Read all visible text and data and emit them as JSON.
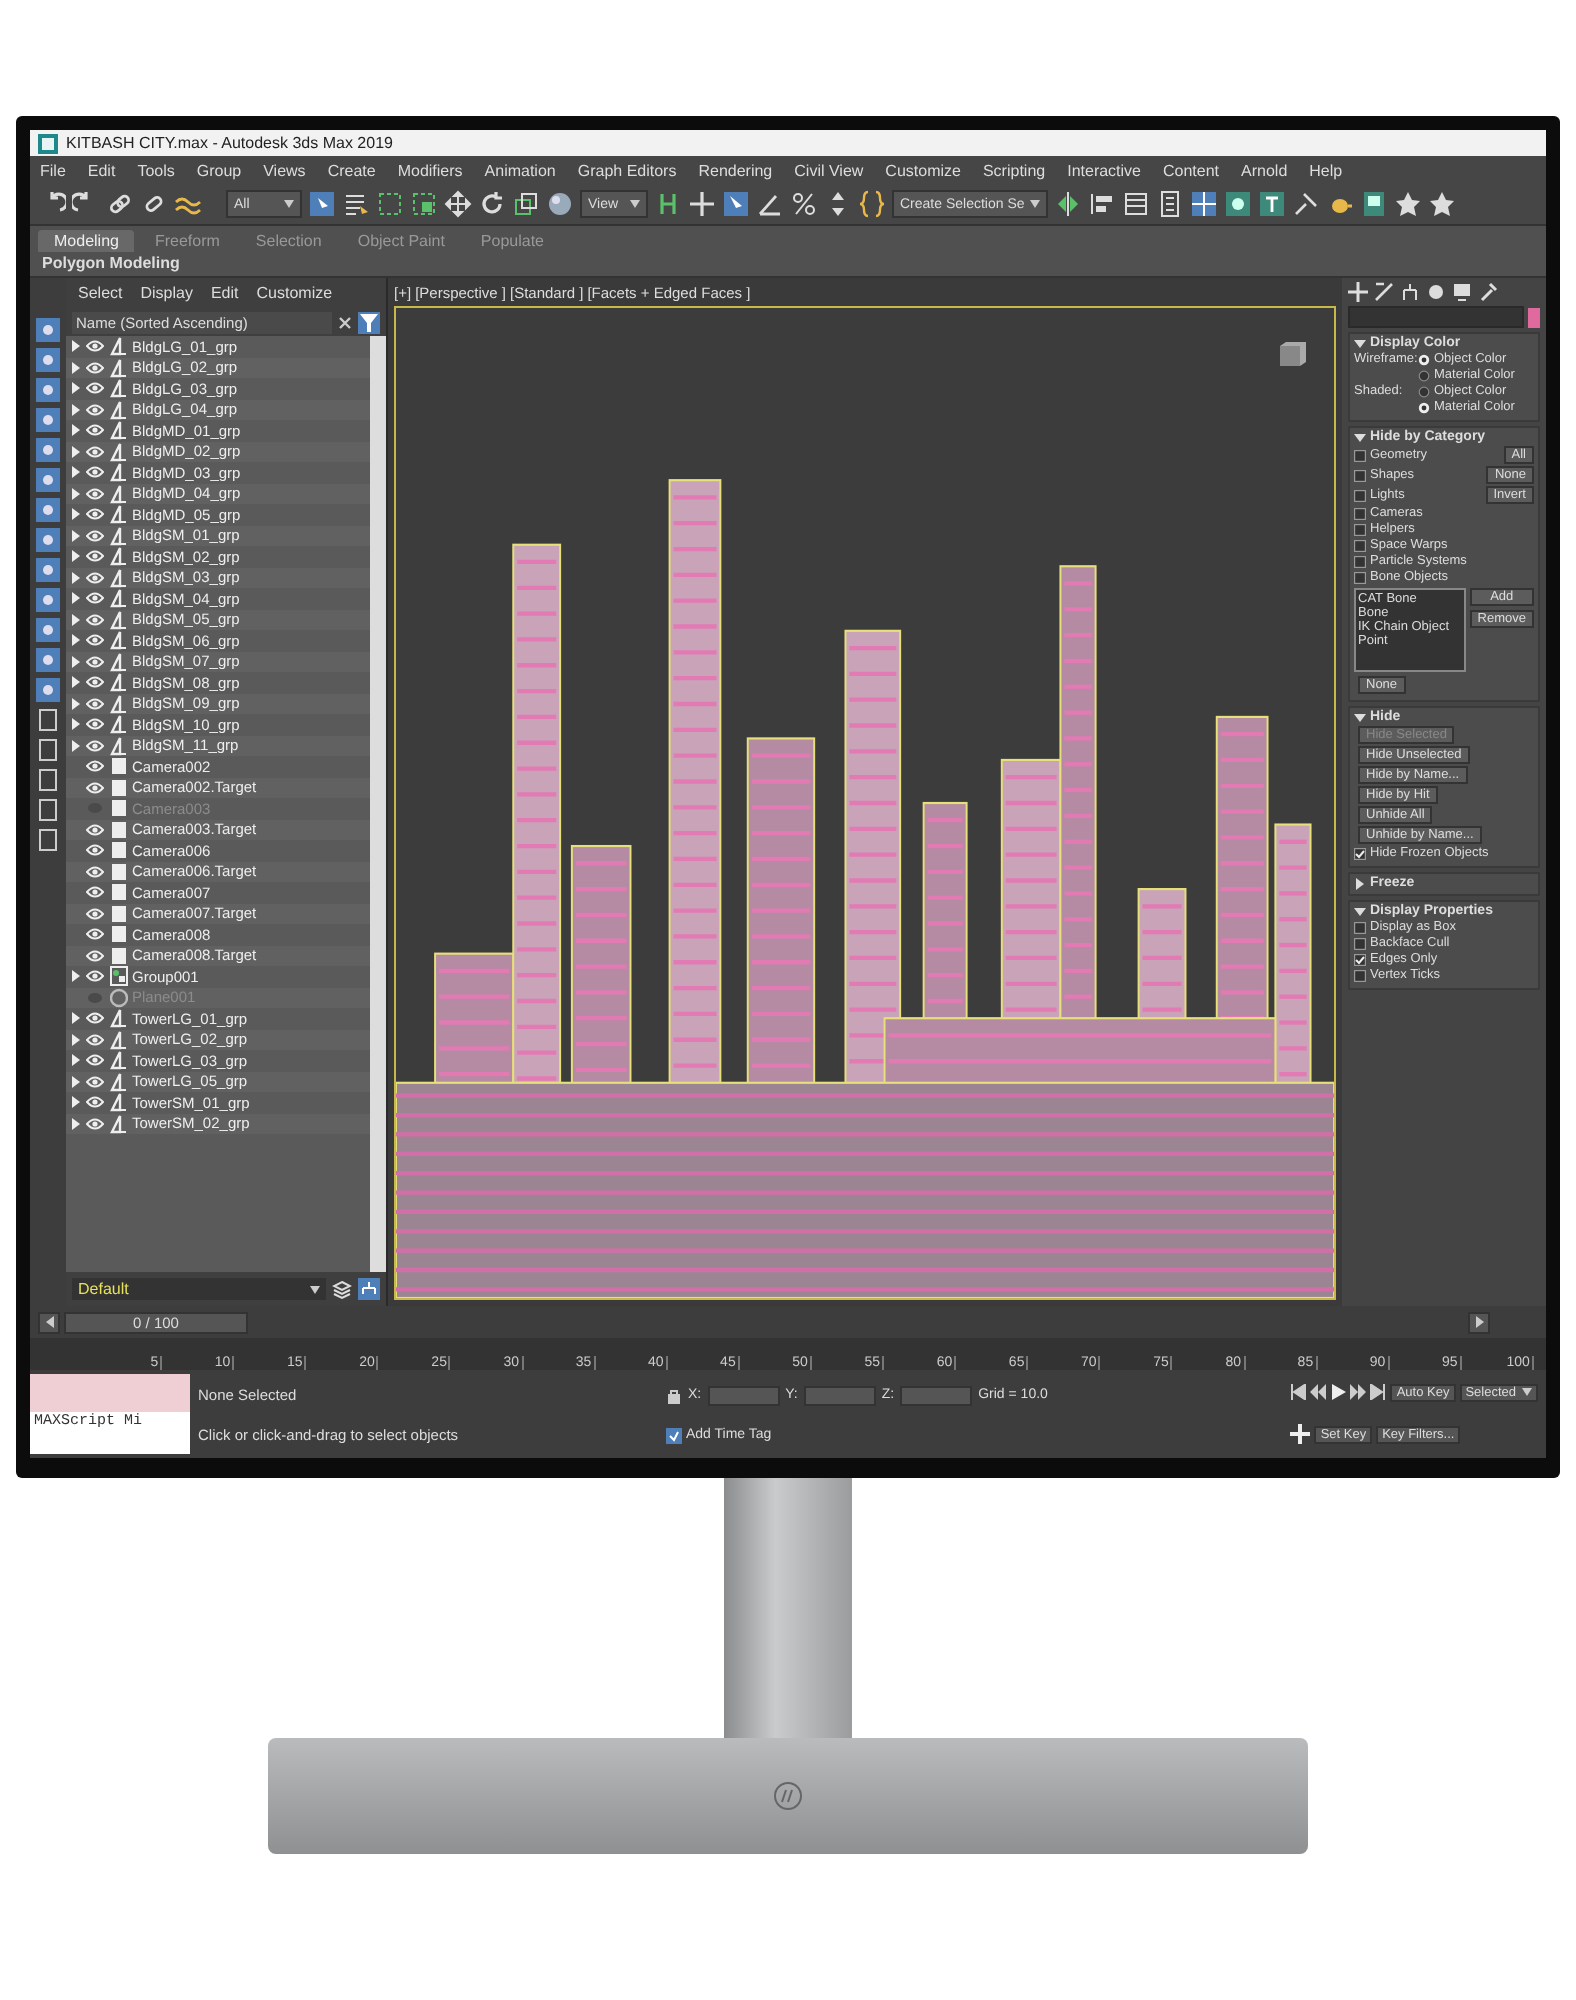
{
  "window": {
    "title": "KITBASH CITY.max - Autodesk 3ds Max 2019"
  },
  "menu": [
    "File",
    "Edit",
    "Tools",
    "Group",
    "Views",
    "Create",
    "Modifiers",
    "Animation",
    "Graph Editors",
    "Rendering",
    "Civil View",
    "Customize",
    "Scripting",
    "Interactive",
    "Content",
    "Arnold",
    "Help"
  ],
  "toolbar": {
    "dropdowns": [
      "All",
      "View",
      "Create Selection Se"
    ]
  },
  "ribbon": {
    "tabs": [
      {
        "label": "Modeling",
        "selected": true
      },
      {
        "label": "Freeform",
        "selected": false
      },
      {
        "label": "Selection",
        "selected": false
      },
      {
        "label": "Object Paint",
        "selected": false
      },
      {
        "label": "Populate",
        "selected": false
      }
    ],
    "panel_title": "Polygon Modeling"
  },
  "explorer": {
    "tabs": [
      "Select",
      "Display",
      "Edit",
      "Customize"
    ],
    "column": "Name (Sorted Ascending)",
    "layer": "Default",
    "items": [
      {
        "name": "BldgLG_01_grp",
        "kind": "group",
        "hidden": false
      },
      {
        "name": "BldgLG_02_grp",
        "kind": "group",
        "hidden": false
      },
      {
        "name": "BldgLG_03_grp",
        "kind": "group",
        "hidden": false
      },
      {
        "name": "BldgLG_04_grp",
        "kind": "group",
        "hidden": false
      },
      {
        "name": "BldgMD_01_grp",
        "kind": "group",
        "hidden": false
      },
      {
        "name": "BldgMD_02_grp",
        "kind": "group",
        "hidden": false
      },
      {
        "name": "BldgMD_03_grp",
        "kind": "group",
        "hidden": false
      },
      {
        "name": "BldgMD_04_grp",
        "kind": "group",
        "hidden": false
      },
      {
        "name": "BldgMD_05_grp",
        "kind": "group",
        "hidden": false
      },
      {
        "name": "BldgSM_01_grp",
        "kind": "group",
        "hidden": false
      },
      {
        "name": "BldgSM_02_grp",
        "kind": "group",
        "hidden": false
      },
      {
        "name": "BldgSM_03_grp",
        "kind": "group",
        "hidden": false
      },
      {
        "name": "BldgSM_04_grp",
        "kind": "group",
        "hidden": false
      },
      {
        "name": "BldgSM_05_grp",
        "kind": "group",
        "hidden": false
      },
      {
        "name": "BldgSM_06_grp",
        "kind": "group",
        "hidden": false
      },
      {
        "name": "BldgSM_07_grp",
        "kind": "group",
        "hidden": false
      },
      {
        "name": "BldgSM_08_grp",
        "kind": "group",
        "hidden": false
      },
      {
        "name": "BldgSM_09_grp",
        "kind": "group",
        "hidden": false
      },
      {
        "name": "BldgSM_10_grp",
        "kind": "group",
        "hidden": false
      },
      {
        "name": "BldgSM_11_grp",
        "kind": "group",
        "hidden": false
      },
      {
        "name": "Camera002",
        "kind": "camera",
        "hidden": false
      },
      {
        "name": "Camera002.Target",
        "kind": "camera",
        "hidden": false
      },
      {
        "name": "Camera003",
        "kind": "camera",
        "hidden": true
      },
      {
        "name": "Camera003.Target",
        "kind": "camera",
        "hidden": false
      },
      {
        "name": "Camera006",
        "kind": "camera",
        "hidden": false
      },
      {
        "name": "Camera006.Target",
        "kind": "camera",
        "hidden": false
      },
      {
        "name": "Camera007",
        "kind": "camera",
        "hidden": false
      },
      {
        "name": "Camera007.Target",
        "kind": "camera",
        "hidden": false
      },
      {
        "name": "Camera008",
        "kind": "camera",
        "hidden": false
      },
      {
        "name": "Camera008.Target",
        "kind": "camera",
        "hidden": false
      },
      {
        "name": "Group001",
        "kind": "set",
        "hidden": false
      },
      {
        "name": "Plane001",
        "kind": "plane",
        "hidden": true
      },
      {
        "name": "TowerLG_01_grp",
        "kind": "group",
        "hidden": false
      },
      {
        "name": "TowerLG_02_grp",
        "kind": "group",
        "hidden": false
      },
      {
        "name": "TowerLG_03_grp",
        "kind": "group",
        "hidden": false
      },
      {
        "name": "TowerLG_05_grp",
        "kind": "group",
        "hidden": false
      },
      {
        "name": "TowerSM_01_grp",
        "kind": "group",
        "hidden": false
      },
      {
        "name": "TowerSM_02_grp",
        "kind": "group",
        "hidden": false
      }
    ]
  },
  "viewport": {
    "labels": [
      "[+]",
      "[Perspective ]",
      "[Standard ]",
      "[Facets + Edged Faces ]"
    ]
  },
  "command_panel": {
    "sections": [
      {
        "title": "Display Color",
        "expanded": true,
        "rows": [
          {
            "kind": "radio",
            "label": "Wireframe:",
            "options": [
              {
                "label": "Object Color",
                "selected": true
              },
              {
                "label": "Material Color",
                "selected": false
              }
            ]
          },
          {
            "kind": "radio",
            "label": "Shaded:",
            "options": [
              {
                "label": "Object Color",
                "selected": false
              },
              {
                "label": "Material Color",
                "selected": true
              }
            ]
          }
        ]
      },
      {
        "title": "Hide by Category",
        "expanded": true,
        "rows": [
          {
            "kind": "check",
            "label": "Geometry",
            "checked": false,
            "button": "All"
          },
          {
            "kind": "check",
            "label": "Shapes",
            "checked": false,
            "button": "None"
          },
          {
            "kind": "check",
            "label": "Lights",
            "checked": false,
            "button": "Invert"
          },
          {
            "kind": "check",
            "label": "Cameras",
            "checked": false
          },
          {
            "kind": "check",
            "label": "Helpers",
            "checked": false
          },
          {
            "kind": "check",
            "label": "Space Warps",
            "checked": false
          },
          {
            "kind": "check",
            "label": "Particle Systems",
            "checked": false
          },
          {
            "kind": "check",
            "label": "Bone Objects",
            "checked": false
          },
          {
            "kind": "list",
            "items": [
              "CAT Bone",
              "Bone",
              "IK Chain Object",
              "Point"
            ],
            "buttons": [
              "Add",
              "Remove"
            ]
          },
          {
            "kind": "button",
            "label": "None",
            "disabled": false
          }
        ]
      },
      {
        "title": "Hide",
        "expanded": true,
        "rows": [
          {
            "kind": "button",
            "label": "Hide Selected",
            "disabled": true
          },
          {
            "kind": "button",
            "label": "Hide Unselected",
            "disabled": false
          },
          {
            "kind": "button",
            "label": "Hide by Name...",
            "disabled": false
          },
          {
            "kind": "button",
            "label": "Hide by Hit",
            "disabled": false
          },
          {
            "kind": "button",
            "label": "Unhide All",
            "disabled": false
          },
          {
            "kind": "button",
            "label": "Unhide by Name...",
            "disabled": false
          },
          {
            "kind": "check",
            "label": "Hide Frozen Objects",
            "checked": true
          }
        ]
      },
      {
        "title": "Freeze",
        "expanded": false
      },
      {
        "title": "Display Properties",
        "expanded": true,
        "rows": [
          {
            "kind": "check",
            "label": "Display as Box",
            "checked": false
          },
          {
            "kind": "check",
            "label": "Backface Cull",
            "checked": false
          },
          {
            "kind": "check",
            "label": "Edges Only",
            "checked": true
          },
          {
            "kind": "check",
            "label": "Vertex Ticks",
            "checked": false
          }
        ]
      }
    ]
  },
  "timeline": {
    "frame": "0 / 100",
    "level": 0,
    "ticks": [
      "5",
      "10",
      "15",
      "20",
      "25",
      "30",
      "35",
      "40",
      "45",
      "50",
      "55",
      "60",
      "65",
      "70",
      "75",
      "80",
      "85",
      "90",
      "95",
      "100"
    ]
  },
  "status": {
    "listener": "MAXScript Mi",
    "selection": "None Selected",
    "prompt": "Click or click-and-drag to select objects",
    "coords": [
      "X:",
      "Y:",
      "Z:"
    ],
    "grid": "Grid = 10.0",
    "time_tag": "Add Time Tag",
    "auto_key": "Auto Key",
    "key_mode": "Selected",
    "set_key": "Set Key",
    "key_filters": "Key Filters..."
  }
}
